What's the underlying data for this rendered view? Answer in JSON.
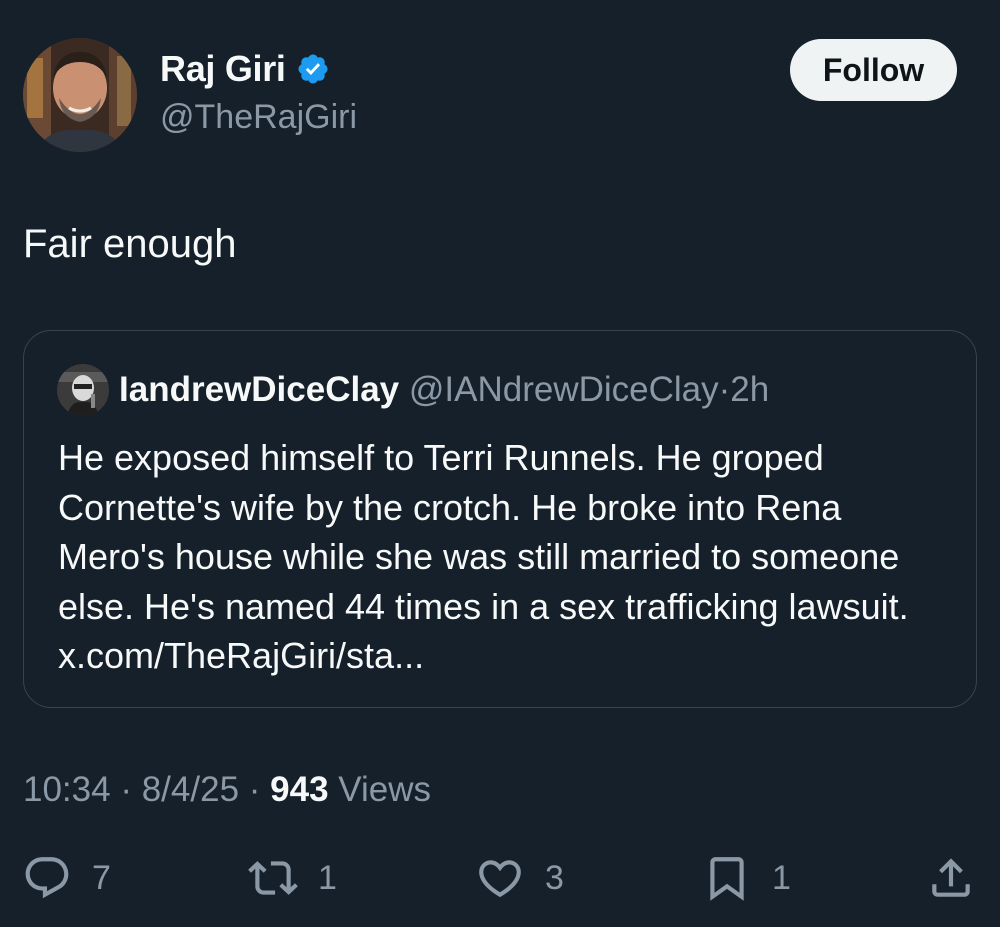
{
  "author": {
    "display_name": "Raj Giri",
    "handle": "@TheRajGiri",
    "verified": true,
    "avatar_icon": "user-avatar-photo"
  },
  "follow_label": "Follow",
  "tweet": {
    "text": "Fair enough"
  },
  "quote": {
    "display_name": "IandrewDiceClay",
    "handle": "@IANdrewDiceClay",
    "separator": "·",
    "time": "2h",
    "text": "He exposed himself to Terri Runnels. He groped Cornette's wife by the crotch. He broke into Rena Mero's house while she was still married to someone else. He's named 44 times in a sex trafficking lawsuit. x.com/TheRajGiri/sta..."
  },
  "meta": {
    "time": "10:34",
    "date": "8/4/25",
    "separator": "·",
    "views_count": "943",
    "views_label": "Views"
  },
  "actions": {
    "replies": "7",
    "reposts": "1",
    "likes": "3",
    "bookmarks": "1"
  },
  "colors": {
    "background": "#15202b",
    "text": "#f7f9f9",
    "secondary": "#8b98a5",
    "border": "#38444d",
    "verified": "#1d9bf0",
    "follow_bg": "#eff3f4"
  }
}
